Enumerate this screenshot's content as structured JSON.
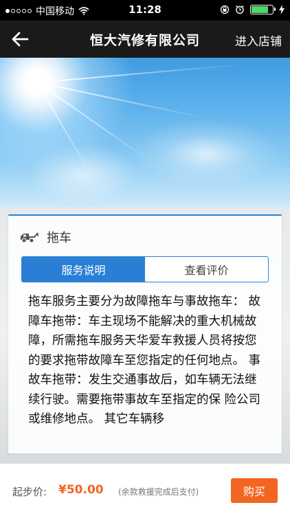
{
  "status_bar": {
    "carrier": "中国移动",
    "time": "11:28",
    "signal_filled": 1,
    "signal_total": 5,
    "battery_level": 0.8,
    "battery_color": "#4cd964"
  },
  "nav": {
    "back_icon": "arrow-left-icon",
    "title": "恒大汽修有限公司",
    "enter_store": "进入店铺"
  },
  "service": {
    "icon": "tow-truck-icon",
    "name": "拖车",
    "tabs": [
      {
        "label": "服务说明",
        "active": true
      },
      {
        "label": "查看评价",
        "active": false
      }
    ],
    "description": "拖车服务主要分为故障拖车与事故拖车： 故障车拖带：车主现场不能解决的重大机械故障，所需拖车服务天华爱车救援人员将按您的要求拖带故障车至您指定的任何地点。 事故车拖带：发生交通事故后，如车辆无法继续行驶。需要拖带事故车至指定的保 险公司或维修地点。 其它车辆移"
  },
  "bottom": {
    "price_label": "起步价:",
    "price": "¥50.00",
    "note": "(余款救援完成后支付)",
    "buy_label": "购买"
  },
  "colors": {
    "accent": "#2a7fd4",
    "price": "#f26522",
    "buy_button": "#f26522"
  }
}
